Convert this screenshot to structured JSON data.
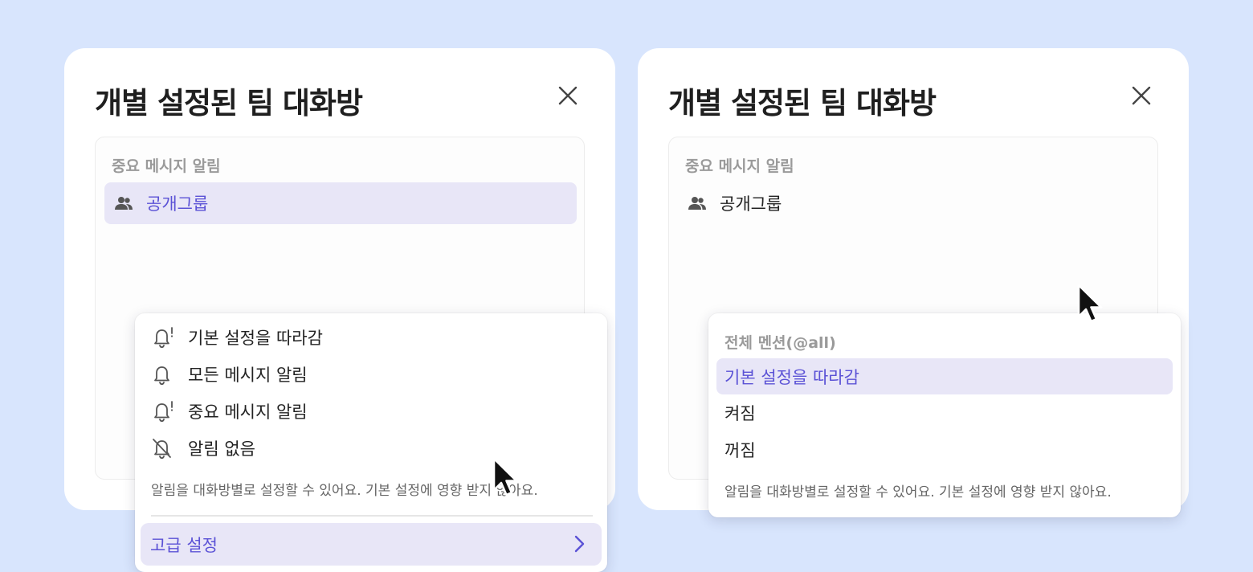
{
  "left_panel": {
    "title": "개별 설정된 팀 대화방",
    "card_label": "중요 메시지 알림",
    "channel": {
      "name": "공개그룹",
      "icon": "people-icon"
    },
    "dropdown": {
      "options": [
        {
          "label": "기본 설정을 따라감",
          "icon": "bell-alert-icon"
        },
        {
          "label": "모든 메시지 알림",
          "icon": "bell-icon"
        },
        {
          "label": "중요 메시지 알림",
          "icon": "bell-alert-icon"
        },
        {
          "label": "알림 없음",
          "icon": "bell-off-icon"
        }
      ],
      "helper": "알림을 대화방별로 설정할 수 있어요. 기본 설정에 영향 받지 않아요.",
      "advanced_label": "고급 설정"
    }
  },
  "right_panel": {
    "title": "개별 설정된 팀 대화방",
    "card_label": "중요 메시지 알림",
    "channel": {
      "name": "공개그룹",
      "icon": "people-icon"
    },
    "dropdown": {
      "section_label": "전체 멘션(@all)",
      "options": [
        {
          "label": "기본 설정을 따라감",
          "selected": true
        },
        {
          "label": "켜짐",
          "selected": false
        },
        {
          "label": "꺼짐",
          "selected": false
        }
      ],
      "helper": "알림을 대화방별로 설정할 수 있어요. 기본 설정에 영향 받지 않아요."
    }
  },
  "colors": {
    "background": "#d8e5fd",
    "accent": "#5b52d6",
    "highlight": "#e8e6f7"
  }
}
